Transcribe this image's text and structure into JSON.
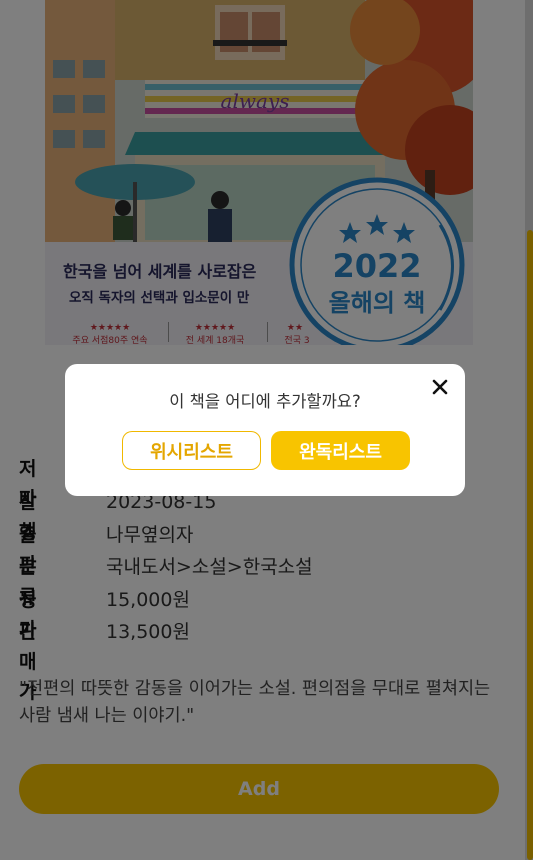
{
  "book": {
    "cover": {
      "store_sign": "always",
      "headline": "한국을 넘어 세계를 사로잡은",
      "subline": "오직 독자의 선택과 입소문이 만",
      "badge_year": "2022",
      "badge_text": "올해의 책",
      "rating_1_stars": "★★★★★",
      "rating_1_text": "주요 서점80주 연속",
      "rating_2_stars": "★★★★★",
      "rating_2_text": "전 세계 18개국",
      "rating_3_stars": "★★",
      "rating_3_text": "전국 3"
    },
    "details": [
      {
        "label": "저자",
        "value": ""
      },
      {
        "label": "발행",
        "value": "2023-08-15"
      },
      {
        "label": "출판",
        "value": "나무옆의자"
      },
      {
        "label": "분류",
        "value": "국내도서>소설>한국소설"
      },
      {
        "label": "정가",
        "value": "15,000원"
      },
      {
        "label": "판매가",
        "value": "13,500원"
      }
    ],
    "description": "\"전편의 따뜻한 감동을 이어가는 소설. 편의점을 무대로 펼쳐지는 사람 냄새 나는 이야기.\"",
    "add_button": "Add"
  },
  "modal": {
    "title": "이 책을 어디에 추가할까요?",
    "close_icon": "close-icon",
    "wishlist_button": "위시리스트",
    "finished_button": "완독리스트"
  },
  "colors": {
    "accent": "#f8c400",
    "overlay": "rgba(0,0,0,0.5)"
  }
}
